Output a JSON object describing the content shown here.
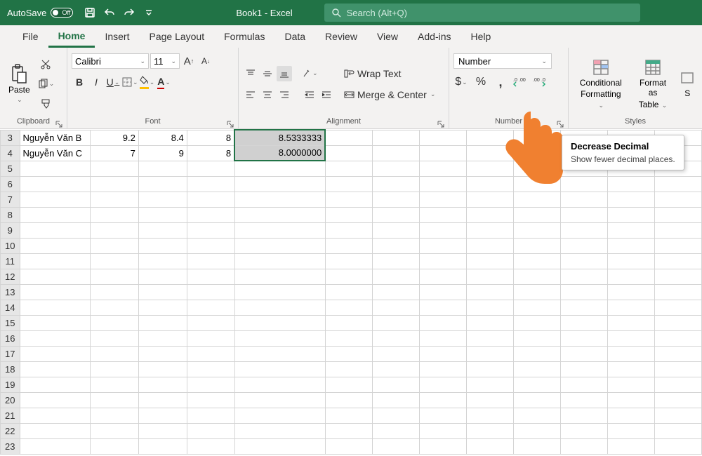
{
  "titlebar": {
    "autosave_label": "AutoSave",
    "autosave_state": "Off",
    "title": "Book1 - Excel",
    "search_placeholder": "Search (Alt+Q)"
  },
  "tabs": [
    "File",
    "Home",
    "Insert",
    "Page Layout",
    "Formulas",
    "Data",
    "Review",
    "View",
    "Add-ins",
    "Help"
  ],
  "active_tab": "Home",
  "clipboard": {
    "label": "Clipboard",
    "paste": "Paste"
  },
  "font": {
    "label": "Font",
    "name": "Calibri",
    "size": "11",
    "bold": "B",
    "italic": "I",
    "underline": "U"
  },
  "alignment": {
    "label": "Alignment",
    "wrap": "Wrap Text",
    "merge": "Merge & Center"
  },
  "number": {
    "label": "Number",
    "format": "Number",
    "currency": "$",
    "percent": "%",
    "comma": ","
  },
  "styles": {
    "label": "Styles",
    "conditional_l1": "Conditional",
    "conditional_l2": "Formatting",
    "table_l1": "Format as",
    "table_l2": "Table",
    "cellstyles": "S"
  },
  "tooltip": {
    "title": "Decrease Decimal",
    "body": "Show fewer decimal places."
  },
  "sheet": {
    "visible_rows": [
      3,
      4,
      5,
      6,
      7,
      8,
      9,
      10,
      11,
      12,
      13,
      14,
      15,
      16,
      17,
      18,
      19,
      20,
      21,
      22,
      23
    ],
    "data": {
      "3": {
        "A": "Nguyễn Văn B",
        "B": "9.2",
        "C": "8.4",
        "D": "8",
        "E": "8.5333333"
      },
      "4": {
        "A": "Nguyễn Văn C",
        "B": "7",
        "C": "9",
        "D": "8",
        "E": "8.0000000"
      }
    },
    "selection": {
      "col": "E",
      "rows": [
        3,
        4
      ]
    }
  }
}
